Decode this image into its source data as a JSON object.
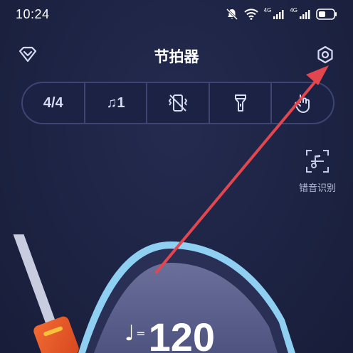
{
  "status_bar": {
    "time": "10:24",
    "signal_label_1": "4G",
    "signal_label_2": "4G",
    "icons": [
      "mute-bell-icon",
      "wifi-icon",
      "signal-icon",
      "signal-icon",
      "battery-icon"
    ]
  },
  "header": {
    "title": "节拍器",
    "left_icon": "vip-diamond-icon",
    "right_icon": "settings-gear-icon"
  },
  "toolbar": {
    "items": [
      {
        "label": "4/4",
        "icon": "time-signature"
      },
      {
        "label": "♫1",
        "icon": "note-subdivision-icon"
      },
      {
        "label": "",
        "icon": "vibration-off-icon"
      },
      {
        "label": "",
        "icon": "flashlight-icon"
      },
      {
        "label": "",
        "icon": "tap-hand-icon"
      }
    ]
  },
  "side_action": {
    "label": "错音识别",
    "icon": "pitch-detect-icon"
  },
  "tempo": {
    "note_symbol": "♩",
    "equals": "=",
    "bpm": "120"
  },
  "colors": {
    "background": "#1e2444",
    "toolbar_border": "#3c4573",
    "dial_face": "#5a5f88",
    "dial_ring": "#8fd0f2",
    "pendulum_weight": "#e8572a",
    "annotation": "#e2474f"
  }
}
